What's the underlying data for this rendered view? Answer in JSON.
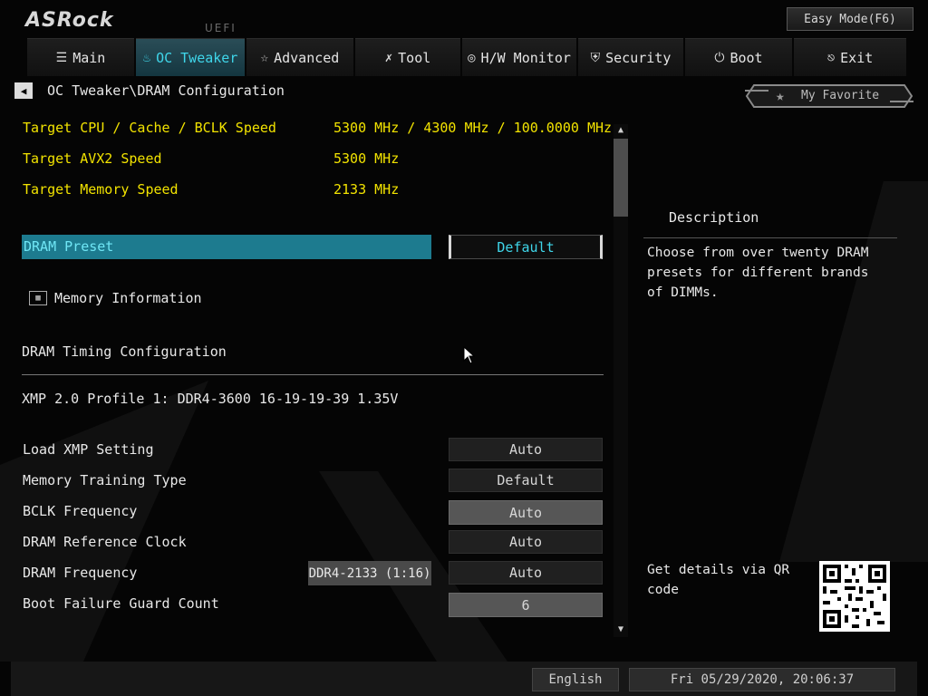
{
  "header": {
    "brand": "ASRock",
    "badge": "UEFI",
    "easy_mode": "Easy Mode(F6)"
  },
  "tabs": [
    {
      "label": "Main",
      "icon": "list-icon"
    },
    {
      "label": "OC Tweaker",
      "icon": "rocket-icon",
      "active": true
    },
    {
      "label": "Advanced",
      "icon": "star-icon"
    },
    {
      "label": "Tool",
      "icon": "tools-icon"
    },
    {
      "label": "H/W Monitor",
      "icon": "monitor-icon"
    },
    {
      "label": "Security",
      "icon": "shield-icon"
    },
    {
      "label": "Boot",
      "icon": "power-icon"
    },
    {
      "label": "Exit",
      "icon": "exit-icon"
    }
  ],
  "breadcrumb": "OC Tweaker\\DRAM Configuration",
  "favorite": "My Favorite",
  "info_rows": [
    {
      "label": "Target CPU / Cache / BCLK Speed",
      "value": "5300 MHz / 4300 MHz / 100.0000 MHz"
    },
    {
      "label": "Target AVX2 Speed",
      "value": "5300 MHz"
    },
    {
      "label": "Target Memory Speed",
      "value": "2133 MHz"
    }
  ],
  "preset": {
    "label": "DRAM Preset",
    "value": "Default"
  },
  "memory_info": "Memory Information",
  "timing_title": "DRAM Timing Configuration",
  "xmp_profile": "XMP 2.0 Profile 1: DDR4-3600 16-19-19-39 1.35V",
  "settings": [
    {
      "label": "Load XMP Setting",
      "value": "Auto"
    },
    {
      "label": "Memory Training Type",
      "value": "Default"
    },
    {
      "label": "BCLK Frequency",
      "value": "Auto"
    },
    {
      "label": "DRAM Reference Clock",
      "value": "Auto"
    },
    {
      "label": "DRAM Frequency",
      "value": "Auto",
      "extra": "DDR4-2133 (1:16)"
    },
    {
      "label": "Boot Failure Guard Count",
      "value": "6"
    }
  ],
  "description": {
    "title": "Description",
    "text": "Choose from over twenty DRAM presets for different brands of DIMMs.",
    "qr_text": "Get details via QR code"
  },
  "footer": {
    "language": "English",
    "datetime": "Fri 05/29/2020, 20:06:37"
  }
}
